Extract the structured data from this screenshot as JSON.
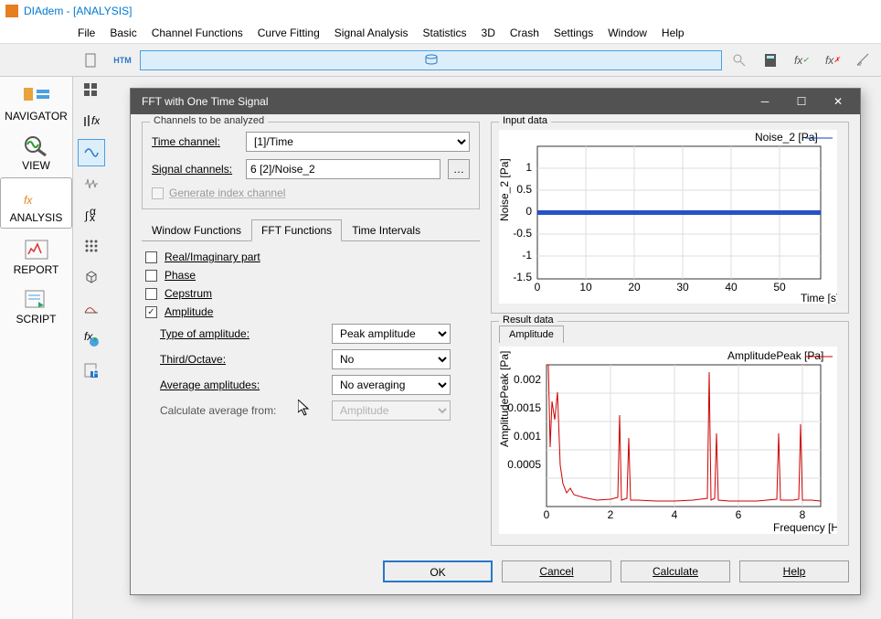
{
  "app": {
    "title": "DIAdem - [ANALYSIS]"
  },
  "menu": [
    "File",
    "Basic",
    "Channel Functions",
    "Curve Fitting",
    "Signal Analysis",
    "Statistics",
    "3D",
    "Crash",
    "Settings",
    "Window",
    "Help"
  ],
  "nav": [
    {
      "label": "NAVIGATOR"
    },
    {
      "label": "VIEW"
    },
    {
      "label": "ANALYSIS",
      "active": true
    },
    {
      "label": "REPORT"
    },
    {
      "label": "SCRIPT"
    }
  ],
  "dialog": {
    "title": "FFT with One Time Signal",
    "channels_label": "Channels to be analyzed",
    "time_label": "Time channel:",
    "time_value": "[1]/Time",
    "signal_label": "Signal channels:",
    "signal_value": "6  [2]/Noise_2",
    "gen_index": "Generate index channel",
    "tabs": [
      "Window Functions",
      "FFT Functions",
      "Time Intervals"
    ],
    "chk_real": "Real/Imaginary part",
    "chk_phase": "Phase",
    "chk_cepstrum": "Cepstrum",
    "chk_amplitude": "Amplitude",
    "opt_type_label": "Type of amplitude:",
    "opt_type_value": "Peak amplitude",
    "opt_third_label": "Third/Octave:",
    "opt_third_value": "No",
    "opt_avg_label": "Average amplitudes:",
    "opt_avg_value": "No averaging",
    "opt_calc_label": "Calculate average from:",
    "opt_calc_value": "Amplitude",
    "input_title": "Input data",
    "result_title": "Result data",
    "result_tab": "Amplitude",
    "input_legend": "Noise_2 [Pa]",
    "result_legend": "AmplitudePeak [Pa]",
    "input_ylabel": "Noise_2 [Pa]",
    "input_xlabel": "Time [s]",
    "result_ylabel": "AmplitudePeak [Pa]",
    "result_xlabel": "Frequency [Hz]",
    "btn_ok": "OK",
    "btn_cancel": "Cancel",
    "btn_calc": "Calculate",
    "btn_help": "Help"
  },
  "chart_data": [
    {
      "type": "line",
      "title": "Input data",
      "xlabel": "Time [s]",
      "ylabel": "Noise_2 [Pa]",
      "xlim": [
        0,
        58
      ],
      "ylim": [
        -1.5,
        1.5
      ],
      "xticks": [
        0,
        10,
        20,
        30,
        40,
        50
      ],
      "yticks": [
        -1.5,
        -1,
        -0.5,
        0,
        0.5,
        1
      ],
      "series": [
        {
          "name": "Noise_2 [Pa]",
          "note": "dense noise signal oscillating around 0 across 0-58s"
        }
      ]
    },
    {
      "type": "line",
      "title": "Result data (Amplitude)",
      "xlabel": "Frequency [Hz]",
      "ylabel": "AmplitudePeak [Pa]",
      "xlim": [
        0,
        8.5
      ],
      "ylim": [
        0,
        0.0022
      ],
      "xticks": [
        0,
        2,
        4,
        6,
        8
      ],
      "yticks": [
        0.0005,
        0.001,
        0.0015,
        0.002
      ],
      "series": [
        {
          "name": "AmplitudePeak [Pa]",
          "peaks": [
            {
              "x": 0.05,
              "y": 0.0022
            },
            {
              "x": 0.3,
              "y": 0.0018
            },
            {
              "x": 2.3,
              "y": 0.0015
            },
            {
              "x": 2.6,
              "y": 0.0012
            },
            {
              "x": 5.1,
              "y": 0.0021
            },
            {
              "x": 5.3,
              "y": 0.0012
            },
            {
              "x": 7.3,
              "y": 0.0012
            },
            {
              "x": 7.9,
              "y": 0.0013
            }
          ],
          "baseline": 0.0002
        }
      ]
    }
  ]
}
